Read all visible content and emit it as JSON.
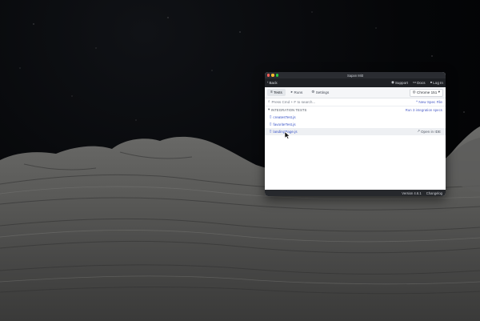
{
  "window": {
    "title": "Sapan Mitt"
  },
  "navbar": {
    "back_label": "Back",
    "support_label": "Support",
    "docs_label": "Docs",
    "login_label": "Log In"
  },
  "tabs": [
    {
      "label": "Tests",
      "icon": "list-icon",
      "active": true
    },
    {
      "label": "Runs",
      "icon": "play-icon",
      "active": false
    },
    {
      "label": "Settings",
      "icon": "gear-icon",
      "active": false
    }
  ],
  "browser_select": {
    "label": "Chrome 151",
    "icon": "chrome-icon"
  },
  "search": {
    "placeholder": "Press Cmd + F to search...",
    "new_spec_label": "New Spec File"
  },
  "section": {
    "title": "INTEGRATION TESTS",
    "run_all_label": "Run 3 integration specs"
  },
  "specs": [
    {
      "name": "createsTest.js"
    },
    {
      "name": "favoriteTest.js"
    },
    {
      "name": "landingPage.js",
      "open_label": "Open in IDE"
    }
  ],
  "statusbar": {
    "version": "Version 4.6.1",
    "changelog": "Changelog"
  },
  "colors": {
    "accent": "#3c56c8",
    "titlebar": "#2a2c31",
    "navbar": "#1f2125",
    "statusbar": "#26282c"
  }
}
